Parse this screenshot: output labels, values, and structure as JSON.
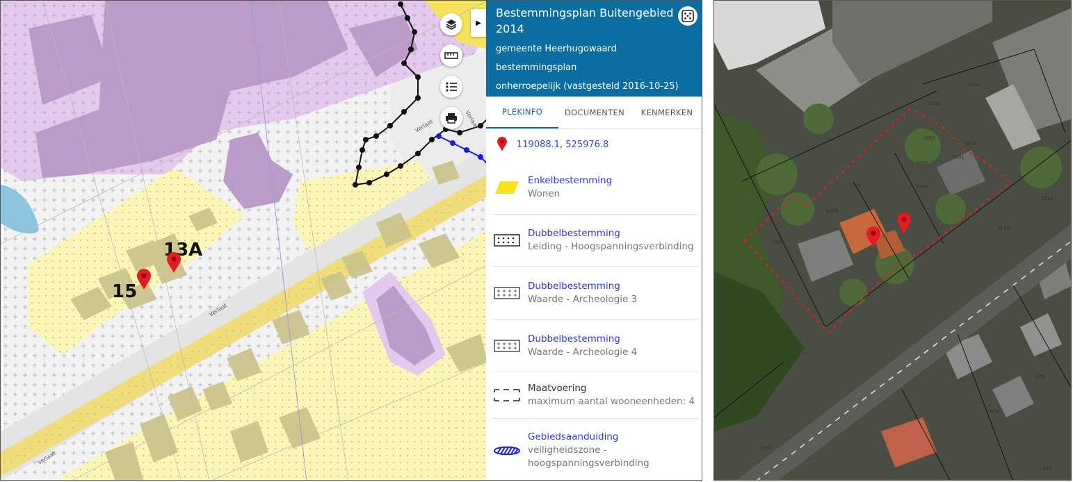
{
  "map": {
    "house_labels": [
      "13A",
      "15"
    ],
    "street_labels": [
      "Verlaat",
      "Verlaat",
      "Verlaat",
      "Verlaat"
    ]
  },
  "toolbar": {
    "buttons": [
      {
        "icon": "layers-icon"
      },
      {
        "icon": "ruler-icon"
      },
      {
        "icon": "legend-list-icon"
      },
      {
        "icon": "print-icon"
      }
    ],
    "collapse_icon": "chevron-right-icon"
  },
  "panel": {
    "title": "Bestemmingsplan Buitengebied 2014",
    "municipality": "gemeente Heerhugowaard",
    "plan_type": "bestemmingsplan",
    "status": "onherroepelijk (vastgesteld 2016-10-25)",
    "header_color": "#0b6da0",
    "tabs": [
      {
        "label": "PLEKINFO",
        "active": true
      },
      {
        "label": "DOCUMENTEN",
        "active": false
      },
      {
        "label": "KENMERKEN",
        "active": false
      }
    ],
    "coordinates": "119088.1, 525976.8",
    "legend": [
      {
        "title": "Enkelbestemming",
        "value": "Wonen",
        "symbol": "yellow-parallelogram",
        "link": true
      },
      {
        "title": "Dubbelbestemming",
        "value": "Leiding - Hoogspanningsverbinding",
        "symbol": "dotted-box",
        "link": true
      },
      {
        "title": "Dubbelbestemming",
        "value": "Waarde - Archeologie 3",
        "symbol": "plus-box",
        "link": true
      },
      {
        "title": "Dubbelbestemming",
        "value": "Waarde - Archeologie 4",
        "symbol": "plus-box",
        "link": true
      },
      {
        "title": "Maatvoering",
        "value": "maximum aantal wooneenheden: 4",
        "symbol": "dashed-box",
        "link": false
      },
      {
        "title": "Gebiedsaanduiding",
        "value": "veiligheidszone - hoogspanningsverbinding",
        "symbol": "blue-hatch",
        "link": true
      }
    ]
  },
  "aerial": {
    "parcel_numbers": [
      "3102",
      "3100",
      "3097",
      "3098",
      "3099",
      "3101",
      "3096",
      "1700",
      "1699",
      "1698",
      "3511",
      "3512",
      "825",
      "826",
      "843",
      "1962"
    ]
  },
  "colors": {
    "residential_yellow": "#fbf6b5",
    "purple_zone": "#e3c9ec",
    "purple_building": "#bb9cc8",
    "road_band": "#efdc7a",
    "marker_red": "#e31b23",
    "link_blue": "#2d3ad6"
  }
}
